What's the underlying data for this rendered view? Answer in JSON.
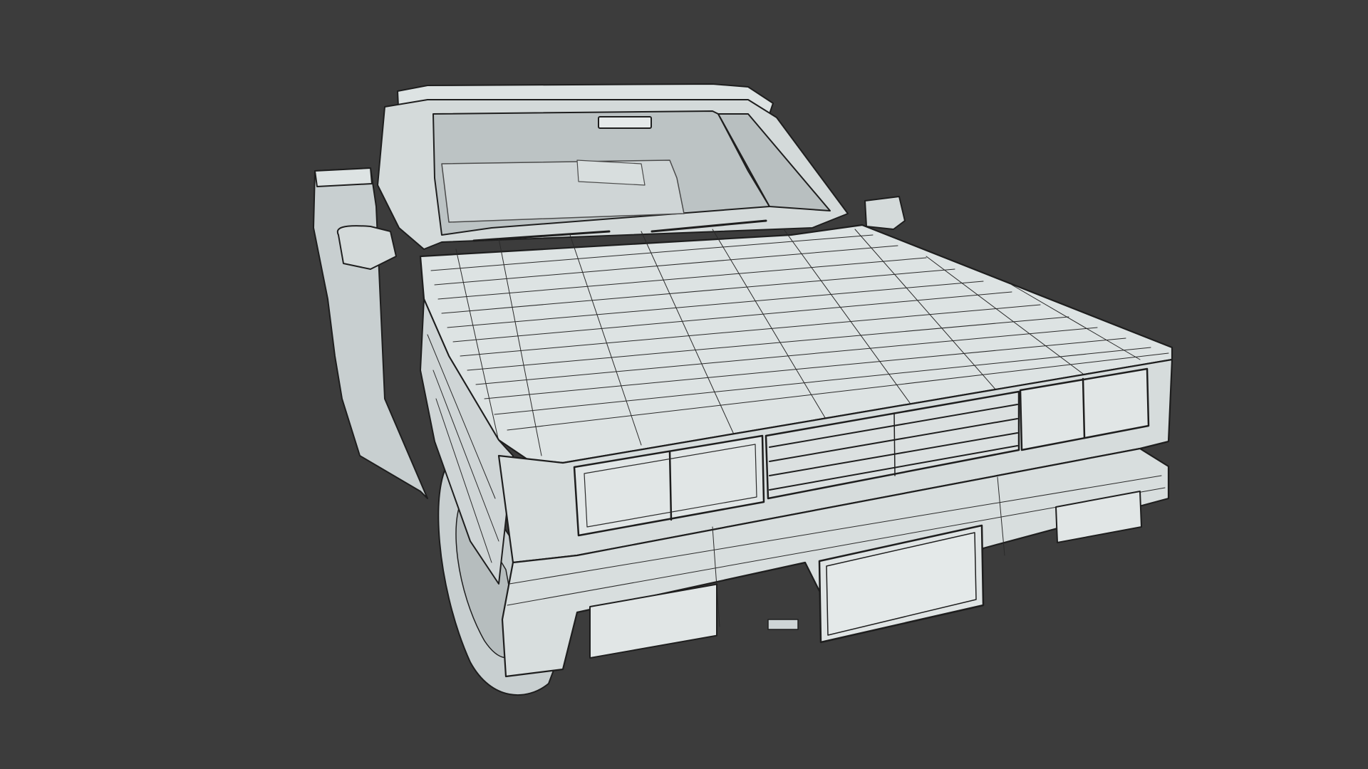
{
  "viewport": {
    "render_mode": "wireframe-on-shaded",
    "subject": "pickup-truck-3d-model"
  },
  "colors": {
    "background": "#3c3c3c",
    "body_fill": "#dde3e3",
    "body_fill_shadow": "#c8cfd0",
    "glass_fill": "#bcc3c4",
    "wire": "#1e1e1e",
    "wire_light": "#4a4a4a"
  }
}
